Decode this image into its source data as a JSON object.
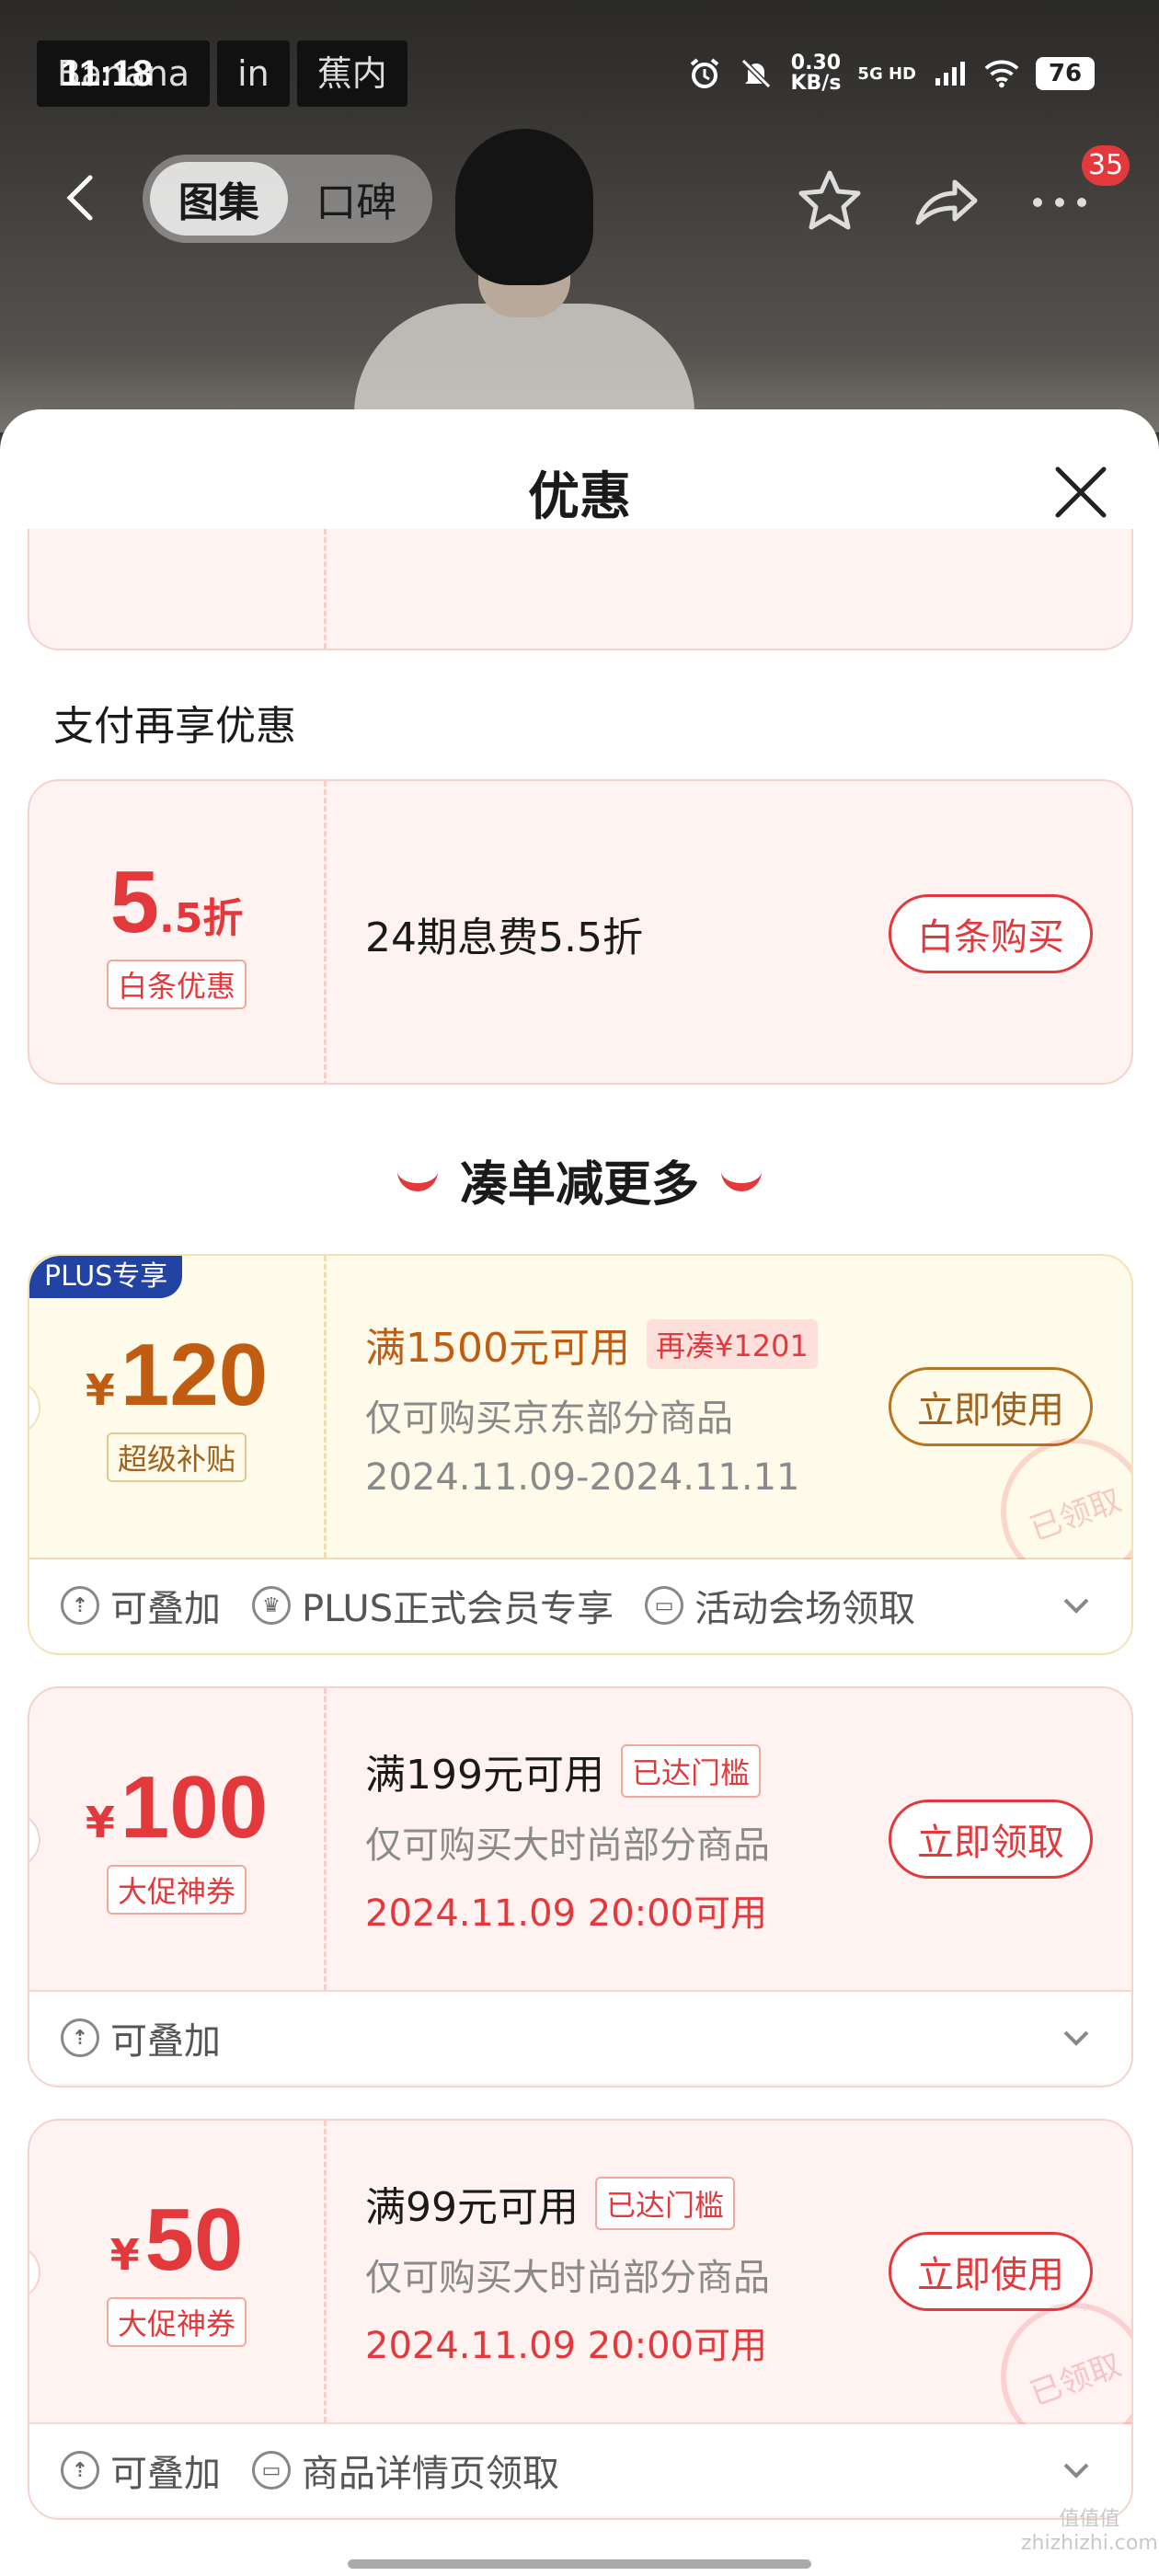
{
  "status_bar": {
    "time": "11:18",
    "brand_parts": [
      "Banana",
      "in",
      "蕉内"
    ],
    "net_speed_value": "0.30",
    "net_speed_unit": "KB/s",
    "network": "5G HD",
    "battery": "76"
  },
  "nav": {
    "tabs": [
      "图集",
      "口碑"
    ],
    "active_tab": "图集",
    "more_badge": "35"
  },
  "sheet": {
    "title": "优惠",
    "section_pay": "支付再享优惠",
    "section_more": "凑单减更多"
  },
  "coupon_baitiao": {
    "amount_big": "5",
    "amount_suffix": ".5折",
    "tag": "白条优惠",
    "condition": "24期息费5.5折",
    "action": "白条购买"
  },
  "coupon_plus": {
    "badge": "PLUS专享",
    "currency": "¥",
    "amount": "120",
    "tag": "超级补贴",
    "condition": "满1500元可用",
    "pill": "再凑¥1201",
    "desc": "仅可购买京东部分商品",
    "date": "2024.11.09-2024.11.11",
    "action": "立即使用",
    "stamp": "已领取",
    "features": [
      "可叠加",
      "PLUS正式会员专享",
      "活动会场领取"
    ]
  },
  "coupon_100": {
    "currency": "¥",
    "amount": "100",
    "tag": "大促神券",
    "condition": "满199元可用",
    "pill": "已达门槛",
    "desc": "仅可购买大时尚部分商品",
    "date": "2024.11.09 20:00可用",
    "action": "立即领取",
    "features": [
      "可叠加"
    ]
  },
  "coupon_50": {
    "currency": "¥",
    "amount": "50",
    "tag": "大促神券",
    "condition": "满99元可用",
    "pill": "已达门槛",
    "desc": "仅可购买大时尚部分商品",
    "date": "2024.11.09 20:00可用",
    "action": "立即使用",
    "stamp": "已领取",
    "features": [
      "可叠加",
      "商品详情页领取"
    ]
  },
  "watermark": {
    "glyphs": "值值值",
    "site": "zhizhizhi.com"
  },
  "colors": {
    "accent_red": "#e4393c",
    "gold": "#c05d12",
    "plus_blue": "#2243a4"
  }
}
